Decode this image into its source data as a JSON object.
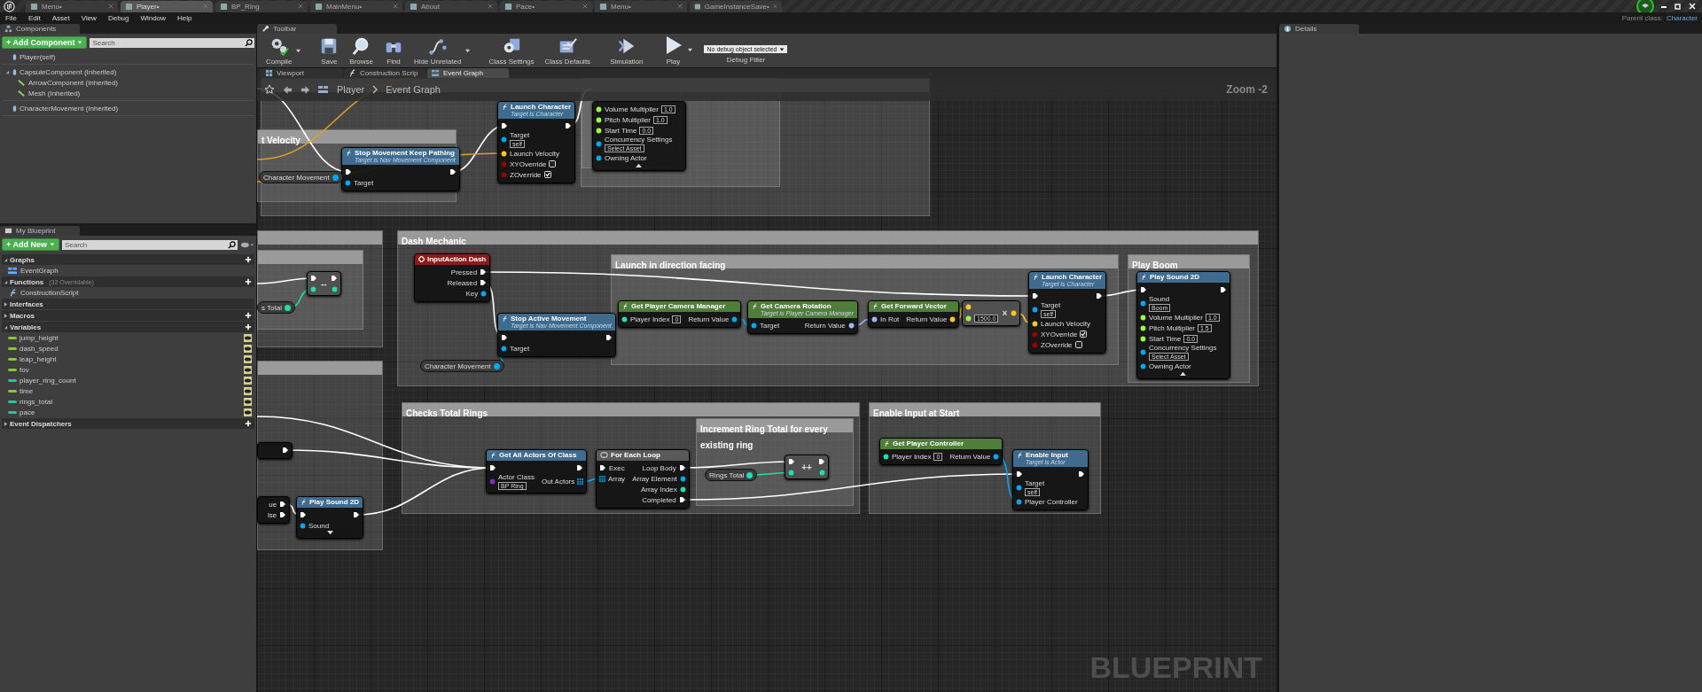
{
  "app_tabs": [
    {
      "label": "Menu•",
      "selected": false
    },
    {
      "label": "Player•",
      "selected": true
    },
    {
      "label": "BP_Ring",
      "selected": false
    },
    {
      "label": "MainMenu•",
      "selected": false
    },
    {
      "label": "About",
      "selected": false
    },
    {
      "label": "Pace•",
      "selected": false
    },
    {
      "label": "Menu•",
      "selected": false
    },
    {
      "label": "GameInstanceSave•",
      "selected": false
    }
  ],
  "parent_class": {
    "label": "Parent class:",
    "value": "Character"
  },
  "menu": [
    "File",
    "Edit",
    "Asset",
    "View",
    "Debug",
    "Window",
    "Help"
  ],
  "components_panel": {
    "title": "Components",
    "add_button": "+ Add Component",
    "search_placeholder": "Search",
    "tree": [
      {
        "label": "Player(self)",
        "expanded": false
      },
      {
        "label": "CapsuleComponent (Inherited)",
        "expanded": true,
        "children": [
          {
            "label": "ArrowComponent (Inherited)",
            "expanded": false
          },
          {
            "label": "Mesh (Inherited)",
            "expanded": false
          }
        ]
      },
      {
        "label": "CharacterMovement (Inherited)",
        "expanded": false
      }
    ]
  },
  "my_blueprint": {
    "title": "My Blueprint",
    "add_button": "+ Add New",
    "search_placeholder": "Search",
    "sections": [
      {
        "label": "Graphs",
        "expanded": true,
        "addable": true,
        "items": [
          {
            "label": "EventGraph",
            "kind": "graph"
          }
        ]
      },
      {
        "label": "Functions",
        "note": "(32 Overridable)",
        "expanded": true,
        "addable": true,
        "items": [
          {
            "label": "ConstructionScript",
            "kind": "function"
          }
        ]
      },
      {
        "label": "Interfaces",
        "expanded": false,
        "addable": false
      },
      {
        "label": "Macros",
        "expanded": false,
        "addable": true
      },
      {
        "label": "Variables",
        "expanded": true,
        "addable": true,
        "items": [
          {
            "label": "jump_height",
            "kind": "variable",
            "color": "#8ac43a"
          },
          {
            "label": "dash_speed",
            "kind": "variable",
            "color": "#8ac43a"
          },
          {
            "label": "leap_height",
            "kind": "variable",
            "color": "#8ac43a"
          },
          {
            "label": "fov",
            "kind": "variable",
            "color": "#8ac43a"
          },
          {
            "label": "player_ring_count",
            "kind": "variable",
            "color": "#1ec8a0"
          },
          {
            "label": "time",
            "kind": "variable",
            "color": "#8ac43a"
          },
          {
            "label": "rings_total",
            "kind": "variable",
            "color": "#1ec8a0"
          },
          {
            "label": "pace",
            "kind": "variable",
            "color": "#1ec8a0"
          }
        ]
      },
      {
        "label": "Event Dispatchers",
        "expanded": false,
        "addable": true
      }
    ]
  },
  "toolbar": {
    "title": "Toolbar",
    "buttons": [
      {
        "label": "Compile",
        "kind": "compile",
        "has_menu": true
      },
      {
        "label": "Save",
        "kind": "save",
        "has_menu": false
      },
      {
        "label": "Browse",
        "kind": "browse",
        "has_menu": false
      },
      {
        "label": "Find",
        "kind": "find",
        "has_menu": false
      },
      {
        "label": "Hide Unrelated",
        "kind": "hide",
        "has_menu": true
      },
      {
        "label": "Class Settings",
        "kind": "settings",
        "has_menu": false
      },
      {
        "label": "Class Defaults",
        "kind": "defaults",
        "has_menu": false
      },
      {
        "label": "Simulation",
        "kind": "simulation",
        "has_menu": false
      },
      {
        "label": "Play",
        "kind": "play",
        "has_menu": true
      }
    ],
    "debug_select": "No debug object selected",
    "debug_label": "Debug Filter"
  },
  "graph_tabs": [
    {
      "label": "Viewport",
      "kind": "viewport",
      "selected": false
    },
    {
      "label": "Construction Scrip",
      "kind": "function",
      "selected": false
    },
    {
      "label": "Event Graph",
      "kind": "graph",
      "selected": true
    }
  ],
  "breadcrumb": [
    "Player",
    "Event Graph"
  ],
  "zoom": "Zoom -2",
  "graph_label": "BLUEPRINT",
  "comments": [
    {
      "title": "t Velocity"
    },
    {
      "title": "Dash Mechanic"
    },
    {
      "title": "Launch in direction facing"
    },
    {
      "title": "Play Boom"
    },
    {
      "title": "Checks Total Rings"
    },
    {
      "title": "Increment Ring Total for every existing ring"
    },
    {
      "title": "Enable Input at Start"
    }
  ],
  "nodes": [
    {
      "kind": "function",
      "title": "Launch Character",
      "subtitle": "Target is Character",
      "color": "#3e6b8e",
      "inputs": [
        {
          "kind": "exec"
        },
        {
          "kind": "object",
          "label": "Target",
          "value": "self"
        },
        {
          "kind": "vector",
          "label": "Launch Velocity"
        },
        {
          "kind": "bool",
          "label": "XYOverride",
          "checked": false
        },
        {
          "kind": "bool",
          "label": "ZOverride",
          "checked": true
        }
      ],
      "outputs": [
        {
          "kind": "exec"
        }
      ]
    },
    {
      "kind": "function",
      "inputs": [
        {
          "kind": "float",
          "label": "Volume Multiplier",
          "value": "1.0"
        },
        {
          "kind": "float",
          "label": "Pitch Multiplier",
          "value": "1.0"
        },
        {
          "kind": "float",
          "label": "Start Time",
          "value": "0.0"
        },
        {
          "kind": "object",
          "label": "Concurrency Settings",
          "value": "Select Asset"
        },
        {
          "kind": "object",
          "label": "Owning Actor"
        }
      ],
      "advanced_expanded": true
    },
    {
      "kind": "function",
      "title": "Stop Movement Keep Pathing",
      "subtitle": "Target is Nav Movement Component",
      "color": "#3e6b8e",
      "inputs": [
        {
          "kind": "exec"
        },
        {
          "kind": "object",
          "label": "Target"
        }
      ],
      "outputs": [
        {
          "kind": "exec"
        }
      ]
    },
    {
      "kind": "variable",
      "label": "Character Movement",
      "color": "#00a8f4"
    },
    {
      "kind": "operator",
      "symbol": "--",
      "inputs": [
        {
          "kind": "exec"
        },
        {
          "kind": "int"
        }
      ],
      "outputs": [
        {
          "kind": "exec"
        },
        {
          "kind": "int"
        }
      ]
    },
    {
      "kind": "variable",
      "label": "s Total",
      "color": "#1fe0ac"
    },
    {
      "kind": "event",
      "title": "InputAction Dash",
      "color": "#8c1c1c",
      "outputs": [
        {
          "kind": "exec",
          "label": "Pressed"
        },
        {
          "kind": "exec",
          "label": "Released"
        },
        {
          "kind": "object",
          "label": "Key"
        }
      ]
    },
    {
      "kind": "function",
      "title": "Stop Active Movement",
      "subtitle": "Target is Nav Movement Component",
      "color": "#3e6b8e",
      "inputs": [
        {
          "kind": "exec"
        },
        {
          "kind": "object",
          "label": "Target"
        }
      ],
      "outputs": [
        {
          "kind": "exec"
        }
      ]
    },
    {
      "kind": "variable",
      "label": "Character Movement",
      "color": "#00a8f4"
    },
    {
      "kind": "function",
      "title": "Get Player Camera Manager",
      "color": "#4f7d3a",
      "inputs": [
        {
          "kind": "int",
          "label": "Player Index",
          "value": "0"
        }
      ],
      "outputs": [
        {
          "kind": "object",
          "label": "Return Value"
        }
      ]
    },
    {
      "kind": "function",
      "title": "Get Camera Rotation",
      "subtitle": "Target is Player Camera Manager",
      "color": "#4f7d3a",
      "inputs": [
        {
          "kind": "object",
          "label": "Target"
        }
      ],
      "outputs": [
        {
          "kind": "rotator",
          "label": "Return Value"
        }
      ]
    },
    {
      "kind": "function",
      "title": "Get Forward Vector",
      "color": "#4f7d3a",
      "inputs": [
        {
          "kind": "rotator",
          "label": "In Rot"
        }
      ],
      "outputs": [
        {
          "kind": "vector",
          "label": "Return Value"
        }
      ]
    },
    {
      "kind": "operator",
      "symbol": "×",
      "inputs": [
        {
          "kind": "vector"
        },
        {
          "kind": "float",
          "value": "1500.0"
        }
      ],
      "outputs": [
        {
          "kind": "vector"
        }
      ]
    },
    {
      "kind": "function",
      "title": "Launch Character",
      "subtitle": "Target is Character",
      "color": "#3e6b8e",
      "inputs": [
        {
          "kind": "exec"
        },
        {
          "kind": "object",
          "label": "Target",
          "value": "self"
        },
        {
          "kind": "vector",
          "label": "Launch Velocity"
        },
        {
          "kind": "bool",
          "label": "XYOverride",
          "checked": true
        },
        {
          "kind": "bool",
          "label": "ZOverride",
          "checked": false
        }
      ],
      "outputs": [
        {
          "kind": "exec"
        }
      ]
    },
    {
      "kind": "function",
      "title": "Play Sound 2D",
      "color": "#3e6b8e",
      "inputs": [
        {
          "kind": "exec"
        },
        {
          "kind": "object",
          "label": "Sound",
          "value": "Boom"
        },
        {
          "kind": "float",
          "label": "Volume Multiplier",
          "value": "1.0"
        },
        {
          "kind": "float",
          "label": "Pitch Multiplier",
          "value": "1.5"
        },
        {
          "kind": "float",
          "label": "Start Time",
          "value": "0.0"
        },
        {
          "kind": "object",
          "label": "Concurrency Settings",
          "value": "Select Asset"
        },
        {
          "kind": "object",
          "label": "Owning Actor"
        }
      ],
      "outputs": [
        {
          "kind": "exec"
        }
      ],
      "advanced_expanded": true
    },
    {
      "kind": "function",
      "outputs": [
        {
          "kind": "exec"
        }
      ]
    },
    {
      "kind": "function",
      "outputs": [
        {
          "kind": "exec",
          "label": "ue"
        },
        {
          "kind": "exec",
          "label": "lse"
        }
      ]
    },
    {
      "kind": "function",
      "title": "Play Sound 2D",
      "color": "#3e6b8e",
      "inputs": [
        {
          "kind": "exec"
        },
        {
          "kind": "object",
          "label": "Sound"
        }
      ],
      "outputs": [
        {
          "kind": "exec"
        }
      ],
      "advanced_expanded": false
    },
    {
      "kind": "function",
      "title": "Get All Actors Of Class",
      "color": "#3e6b8e",
      "inputs": [
        {
          "kind": "exec"
        },
        {
          "kind": "class",
          "label": "Actor Class",
          "value": "BP Ring"
        }
      ],
      "outputs": [
        {
          "kind": "exec"
        },
        {
          "kind": "array",
          "label": "Out Actors"
        }
      ]
    },
    {
      "kind": "macro",
      "title": "For Each Loop",
      "color": "#5a5a5a",
      "inputs": [
        {
          "kind": "exec",
          "label": "Exec"
        },
        {
          "kind": "array",
          "label": "Array"
        }
      ],
      "outputs": [
        {
          "kind": "exec",
          "label": "Loop Body"
        },
        {
          "kind": "object",
          "label": "Array Element"
        },
        {
          "kind": "int",
          "label": "Array Index"
        },
        {
          "kind": "exec",
          "label": "Completed"
        }
      ]
    },
    {
      "kind": "variable",
      "label": "Rings Total",
      "color": "#1fe0ac"
    },
    {
      "kind": "operator",
      "symbol": "++",
      "inputs": [
        {
          "kind": "exec"
        },
        {
          "kind": "int"
        }
      ],
      "outputs": [
        {
          "kind": "exec"
        },
        {
          "kind": "int"
        }
      ]
    },
    {
      "kind": "function",
      "title": "Get Player Controller",
      "color": "#4f7d3a",
      "inputs": [
        {
          "kind": "int",
          "label": "Player Index",
          "value": "0"
        }
      ],
      "outputs": [
        {
          "kind": "object",
          "label": "Return Value"
        }
      ]
    },
    {
      "kind": "function",
      "title": "Enable Input",
      "subtitle": "Target is Actor",
      "color": "#3e6b8e",
      "inputs": [
        {
          "kind": "exec"
        },
        {
          "kind": "object",
          "label": "Target",
          "value": "self"
        },
        {
          "kind": "object",
          "label": "Player Controller"
        }
      ],
      "outputs": [
        {
          "kind": "exec"
        }
      ]
    }
  ],
  "details_panel": {
    "title": "Details"
  }
}
